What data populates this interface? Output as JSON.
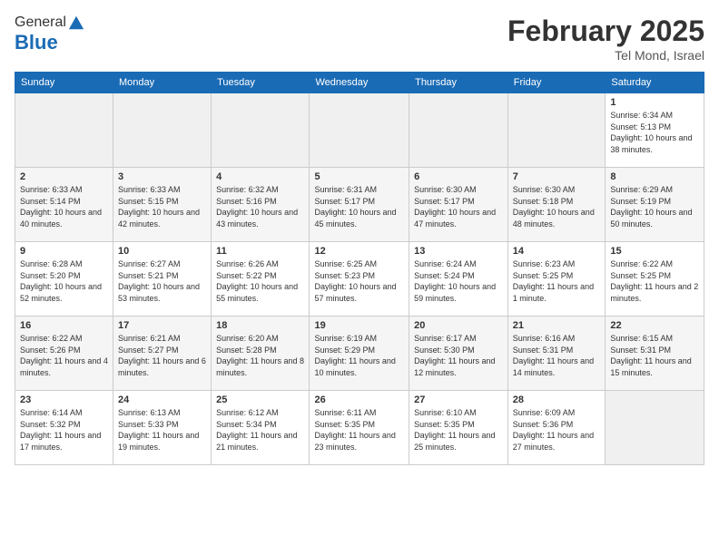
{
  "logo": {
    "line1": "General",
    "line2": "Blue"
  },
  "header": {
    "title": "February 2025",
    "subtitle": "Tel Mond, Israel"
  },
  "days_of_week": [
    "Sunday",
    "Monday",
    "Tuesday",
    "Wednesday",
    "Thursday",
    "Friday",
    "Saturday"
  ],
  "weeks": [
    [
      {
        "day": "",
        "info": ""
      },
      {
        "day": "",
        "info": ""
      },
      {
        "day": "",
        "info": ""
      },
      {
        "day": "",
        "info": ""
      },
      {
        "day": "",
        "info": ""
      },
      {
        "day": "",
        "info": ""
      },
      {
        "day": "1",
        "info": "Sunrise: 6:34 AM\nSunset: 5:13 PM\nDaylight: 10 hours and 38 minutes."
      }
    ],
    [
      {
        "day": "2",
        "info": "Sunrise: 6:33 AM\nSunset: 5:14 PM\nDaylight: 10 hours and 40 minutes."
      },
      {
        "day": "3",
        "info": "Sunrise: 6:33 AM\nSunset: 5:15 PM\nDaylight: 10 hours and 42 minutes."
      },
      {
        "day": "4",
        "info": "Sunrise: 6:32 AM\nSunset: 5:16 PM\nDaylight: 10 hours and 43 minutes."
      },
      {
        "day": "5",
        "info": "Sunrise: 6:31 AM\nSunset: 5:17 PM\nDaylight: 10 hours and 45 minutes."
      },
      {
        "day": "6",
        "info": "Sunrise: 6:30 AM\nSunset: 5:17 PM\nDaylight: 10 hours and 47 minutes."
      },
      {
        "day": "7",
        "info": "Sunrise: 6:30 AM\nSunset: 5:18 PM\nDaylight: 10 hours and 48 minutes."
      },
      {
        "day": "8",
        "info": "Sunrise: 6:29 AM\nSunset: 5:19 PM\nDaylight: 10 hours and 50 minutes."
      }
    ],
    [
      {
        "day": "9",
        "info": "Sunrise: 6:28 AM\nSunset: 5:20 PM\nDaylight: 10 hours and 52 minutes."
      },
      {
        "day": "10",
        "info": "Sunrise: 6:27 AM\nSunset: 5:21 PM\nDaylight: 10 hours and 53 minutes."
      },
      {
        "day": "11",
        "info": "Sunrise: 6:26 AM\nSunset: 5:22 PM\nDaylight: 10 hours and 55 minutes."
      },
      {
        "day": "12",
        "info": "Sunrise: 6:25 AM\nSunset: 5:23 PM\nDaylight: 10 hours and 57 minutes."
      },
      {
        "day": "13",
        "info": "Sunrise: 6:24 AM\nSunset: 5:24 PM\nDaylight: 10 hours and 59 minutes."
      },
      {
        "day": "14",
        "info": "Sunrise: 6:23 AM\nSunset: 5:25 PM\nDaylight: 11 hours and 1 minute."
      },
      {
        "day": "15",
        "info": "Sunrise: 6:22 AM\nSunset: 5:25 PM\nDaylight: 11 hours and 2 minutes."
      }
    ],
    [
      {
        "day": "16",
        "info": "Sunrise: 6:22 AM\nSunset: 5:26 PM\nDaylight: 11 hours and 4 minutes."
      },
      {
        "day": "17",
        "info": "Sunrise: 6:21 AM\nSunset: 5:27 PM\nDaylight: 11 hours and 6 minutes."
      },
      {
        "day": "18",
        "info": "Sunrise: 6:20 AM\nSunset: 5:28 PM\nDaylight: 11 hours and 8 minutes."
      },
      {
        "day": "19",
        "info": "Sunrise: 6:19 AM\nSunset: 5:29 PM\nDaylight: 11 hours and 10 minutes."
      },
      {
        "day": "20",
        "info": "Sunrise: 6:17 AM\nSunset: 5:30 PM\nDaylight: 11 hours and 12 minutes."
      },
      {
        "day": "21",
        "info": "Sunrise: 6:16 AM\nSunset: 5:31 PM\nDaylight: 11 hours and 14 minutes."
      },
      {
        "day": "22",
        "info": "Sunrise: 6:15 AM\nSunset: 5:31 PM\nDaylight: 11 hours and 15 minutes."
      }
    ],
    [
      {
        "day": "23",
        "info": "Sunrise: 6:14 AM\nSunset: 5:32 PM\nDaylight: 11 hours and 17 minutes."
      },
      {
        "day": "24",
        "info": "Sunrise: 6:13 AM\nSunset: 5:33 PM\nDaylight: 11 hours and 19 minutes."
      },
      {
        "day": "25",
        "info": "Sunrise: 6:12 AM\nSunset: 5:34 PM\nDaylight: 11 hours and 21 minutes."
      },
      {
        "day": "26",
        "info": "Sunrise: 6:11 AM\nSunset: 5:35 PM\nDaylight: 11 hours and 23 minutes."
      },
      {
        "day": "27",
        "info": "Sunrise: 6:10 AM\nSunset: 5:35 PM\nDaylight: 11 hours and 25 minutes."
      },
      {
        "day": "28",
        "info": "Sunrise: 6:09 AM\nSunset: 5:36 PM\nDaylight: 11 hours and 27 minutes."
      },
      {
        "day": "",
        "info": ""
      }
    ]
  ]
}
